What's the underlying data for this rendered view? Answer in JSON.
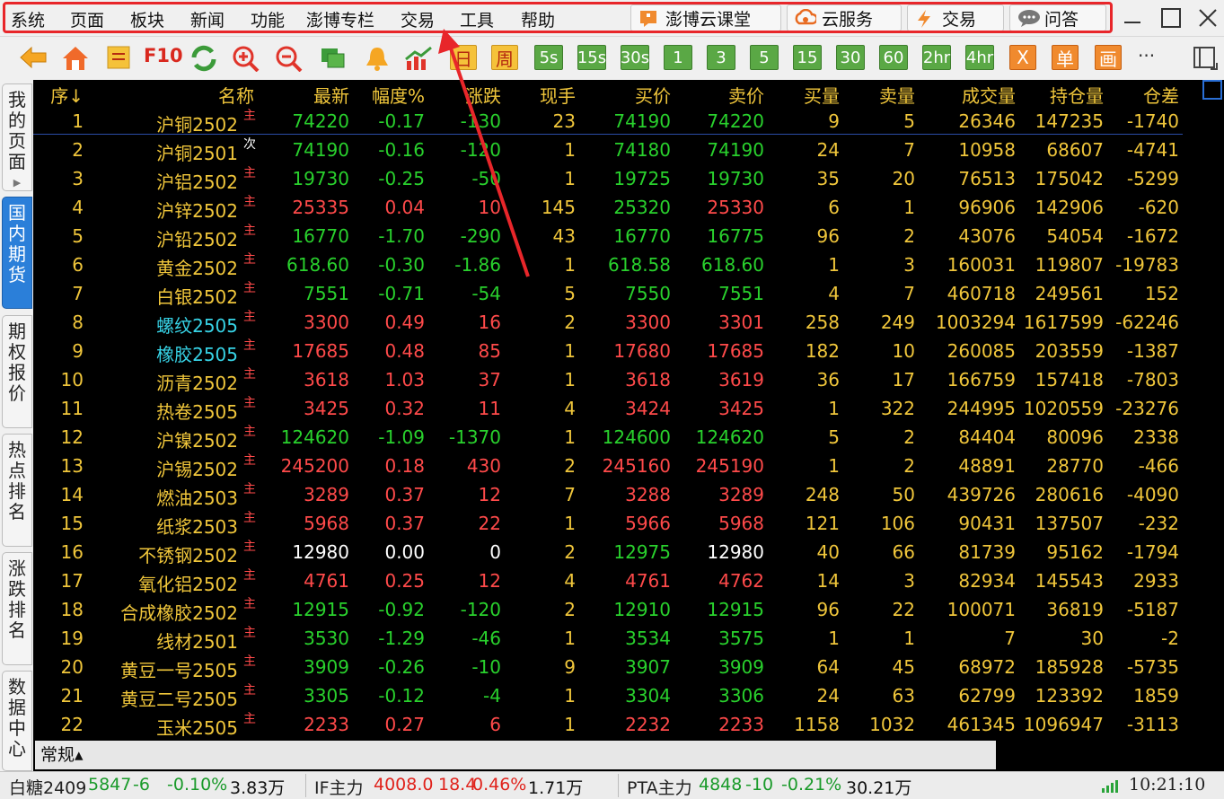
{
  "colors": {
    "up": "#ff4a4a",
    "down": "#29d12d",
    "flat": "#ffffff",
    "yellow": "#f0c63b",
    "cyan": "#37d3e6",
    "highlight": "#e8262a"
  },
  "menu": [
    "系统",
    "页面",
    "板块",
    "新闻",
    "功能",
    "澎博专栏",
    "交易",
    "工具",
    "帮助"
  ],
  "top_buttons": [
    {
      "label": "澎博云课堂",
      "icon": "classroom-icon"
    },
    {
      "label": "云服务",
      "icon": "cloud-service-icon"
    },
    {
      "label": "交易",
      "icon": "lightning-icon"
    },
    {
      "label": "问答",
      "icon": "chat-icon"
    }
  ],
  "toolbar": {
    "f10": "F10",
    "day": "日",
    "week": "周",
    "periods": [
      "5s",
      "15s",
      "30s",
      "1",
      "3",
      "5",
      "15",
      "30",
      "60",
      "2hr",
      "4hr"
    ],
    "x_label": "X",
    "single_label": "单",
    "draw_label": "画",
    "more": "···"
  },
  "sidebar_tabs": [
    {
      "label": "我的页面",
      "active": false,
      "has_arrow": true
    },
    {
      "label": "国内期货",
      "active": true
    },
    {
      "label": "期权报价",
      "active": false
    },
    {
      "label": "热点排名",
      "active": false
    },
    {
      "label": "涨跌排名",
      "active": false
    },
    {
      "label": "数据中心",
      "active": false
    }
  ],
  "columns": [
    "序↓",
    "名称",
    "最新",
    "幅度%",
    "涨跌",
    "现手",
    "买价",
    "卖价",
    "买量",
    "卖量",
    "成交量",
    "持仓量",
    "仓差"
  ],
  "rows": [
    {
      "no": "1",
      "name": "沪铜2502",
      "tag": "主",
      "last": "74220",
      "pct": "-0.17",
      "chg": "-130",
      "hand": "23",
      "bid": "74190",
      "ask": "74220",
      "bidv": "9",
      "askv": "5",
      "vol": "26346",
      "oi": "147235",
      "oic": "-1740",
      "dir": "down",
      "name_color": "yellow"
    },
    {
      "no": "2",
      "name": "沪铜2501",
      "tag": "次",
      "last": "74190",
      "pct": "-0.16",
      "chg": "-120",
      "hand": "1",
      "bid": "74180",
      "ask": "74190",
      "bidv": "24",
      "askv": "7",
      "vol": "10958",
      "oi": "68607",
      "oic": "-4741",
      "dir": "down",
      "name_color": "yellow"
    },
    {
      "no": "3",
      "name": "沪铝2502",
      "tag": "主",
      "last": "19730",
      "pct": "-0.25",
      "chg": "-50",
      "hand": "1",
      "bid": "19725",
      "ask": "19730",
      "bidv": "35",
      "askv": "20",
      "vol": "76513",
      "oi": "175042",
      "oic": "-5299",
      "dir": "down",
      "name_color": "yellow"
    },
    {
      "no": "4",
      "name": "沪锌2502",
      "tag": "主",
      "last": "25335",
      "pct": "0.04",
      "chg": "10",
      "hand": "145",
      "bid": "25320",
      "ask": "25330",
      "bidv": "6",
      "askv": "1",
      "vol": "96906",
      "oi": "142906",
      "oic": "-620",
      "dir": "up",
      "bid_dir": "down",
      "name_color": "yellow"
    },
    {
      "no": "5",
      "name": "沪铅2502",
      "tag": "主",
      "last": "16770",
      "pct": "-1.70",
      "chg": "-290",
      "hand": "43",
      "bid": "16770",
      "ask": "16775",
      "bidv": "96",
      "askv": "2",
      "vol": "43076",
      "oi": "54054",
      "oic": "-1672",
      "dir": "down",
      "name_color": "yellow"
    },
    {
      "no": "6",
      "name": "黄金2502",
      "tag": "主",
      "last": "618.60",
      "pct": "-0.30",
      "chg": "-1.86",
      "hand": "1",
      "bid": "618.58",
      "ask": "618.60",
      "bidv": "1",
      "askv": "3",
      "vol": "160031",
      "oi": "119807",
      "oic": "-19783",
      "dir": "down",
      "name_color": "yellow"
    },
    {
      "no": "7",
      "name": "白银2502",
      "tag": "主",
      "last": "7551",
      "pct": "-0.71",
      "chg": "-54",
      "hand": "5",
      "bid": "7550",
      "ask": "7551",
      "bidv": "4",
      "askv": "7",
      "vol": "460718",
      "oi": "249561",
      "oic": "152",
      "dir": "down",
      "name_color": "yellow"
    },
    {
      "no": "8",
      "name": "螺纹2505",
      "tag": "主",
      "last": "3300",
      "pct": "0.49",
      "chg": "16",
      "hand": "2",
      "bid": "3300",
      "ask": "3301",
      "bidv": "258",
      "askv": "249",
      "vol": "1003294",
      "oi": "1617599",
      "oic": "-62246",
      "dir": "up",
      "name_color": "cyan"
    },
    {
      "no": "9",
      "name": "橡胶2505",
      "tag": "主",
      "last": "17685",
      "pct": "0.48",
      "chg": "85",
      "hand": "1",
      "bid": "17680",
      "ask": "17685",
      "bidv": "182",
      "askv": "10",
      "vol": "260085",
      "oi": "203559",
      "oic": "-1387",
      "dir": "up",
      "name_color": "cyan"
    },
    {
      "no": "10",
      "name": "沥青2502",
      "tag": "主",
      "last": "3618",
      "pct": "1.03",
      "chg": "37",
      "hand": "1",
      "bid": "3618",
      "ask": "3619",
      "bidv": "36",
      "askv": "17",
      "vol": "166759",
      "oi": "157418",
      "oic": "-7803",
      "dir": "up",
      "name_color": "yellow"
    },
    {
      "no": "11",
      "name": "热卷2505",
      "tag": "主",
      "last": "3425",
      "pct": "0.32",
      "chg": "11",
      "hand": "4",
      "bid": "3424",
      "ask": "3425",
      "bidv": "1",
      "askv": "322",
      "vol": "244995",
      "oi": "1020559",
      "oic": "-23276",
      "dir": "up",
      "name_color": "yellow"
    },
    {
      "no": "12",
      "name": "沪镍2502",
      "tag": "主",
      "last": "124620",
      "pct": "-1.09",
      "chg": "-1370",
      "hand": "1",
      "bid": "124600",
      "ask": "124620",
      "bidv": "5",
      "askv": "2",
      "vol": "84404",
      "oi": "80096",
      "oic": "2338",
      "dir": "down",
      "name_color": "yellow"
    },
    {
      "no": "13",
      "name": "沪锡2502",
      "tag": "主",
      "last": "245200",
      "pct": "0.18",
      "chg": "430",
      "hand": "2",
      "bid": "245160",
      "ask": "245190",
      "bidv": "1",
      "askv": "2",
      "vol": "48891",
      "oi": "28770",
      "oic": "-466",
      "dir": "up",
      "name_color": "yellow"
    },
    {
      "no": "14",
      "name": "燃油2503",
      "tag": "主",
      "last": "3289",
      "pct": "0.37",
      "chg": "12",
      "hand": "7",
      "bid": "3288",
      "ask": "3289",
      "bidv": "248",
      "askv": "50",
      "vol": "439726",
      "oi": "280616",
      "oic": "-4090",
      "dir": "up",
      "name_color": "yellow"
    },
    {
      "no": "15",
      "name": "纸浆2503",
      "tag": "主",
      "last": "5968",
      "pct": "0.37",
      "chg": "22",
      "hand": "1",
      "bid": "5966",
      "ask": "5968",
      "bidv": "121",
      "askv": "106",
      "vol": "90431",
      "oi": "137507",
      "oic": "-232",
      "dir": "up",
      "name_color": "yellow"
    },
    {
      "no": "16",
      "name": "不锈钢2502",
      "tag": "主",
      "last": "12980",
      "pct": "0.00",
      "chg": "0",
      "hand": "2",
      "bid": "12975",
      "ask": "12980",
      "bidv": "40",
      "askv": "66",
      "vol": "81739",
      "oi": "95162",
      "oic": "-1794",
      "dir": "flat",
      "bid_dir": "down",
      "name_color": "yellow"
    },
    {
      "no": "17",
      "name": "氧化铝2502",
      "tag": "主",
      "last": "4761",
      "pct": "0.25",
      "chg": "12",
      "hand": "4",
      "bid": "4761",
      "ask": "4762",
      "bidv": "14",
      "askv": "3",
      "vol": "82934",
      "oi": "145543",
      "oic": "2933",
      "dir": "up",
      "name_color": "yellow"
    },
    {
      "no": "18",
      "name": "合成橡胶2502",
      "tag": "主",
      "last": "12915",
      "pct": "-0.92",
      "chg": "-120",
      "hand": "2",
      "bid": "12910",
      "ask": "12915",
      "bidv": "96",
      "askv": "22",
      "vol": "100071",
      "oi": "36819",
      "oic": "-5187",
      "dir": "down",
      "name_color": "yellow"
    },
    {
      "no": "19",
      "name": "线材2501",
      "tag": "主",
      "last": "3530",
      "pct": "-1.29",
      "chg": "-46",
      "hand": "1",
      "bid": "3534",
      "ask": "3575",
      "bidv": "1",
      "askv": "1",
      "vol": "7",
      "oi": "30",
      "oic": "-2",
      "dir": "down",
      "name_color": "yellow"
    },
    {
      "no": "20",
      "name": "黄豆一号2505",
      "tag": "主",
      "last": "3909",
      "pct": "-0.26",
      "chg": "-10",
      "hand": "9",
      "bid": "3907",
      "ask": "3909",
      "bidv": "64",
      "askv": "45",
      "vol": "68972",
      "oi": "185928",
      "oic": "-5735",
      "dir": "down",
      "name_color": "yellow"
    },
    {
      "no": "21",
      "name": "黄豆二号2505",
      "tag": "主",
      "last": "3305",
      "pct": "-0.12",
      "chg": "-4",
      "hand": "1",
      "bid": "3304",
      "ask": "3306",
      "bidv": "24",
      "askv": "63",
      "vol": "62799",
      "oi": "123392",
      "oic": "1859",
      "dir": "down",
      "name_color": "yellow"
    },
    {
      "no": "22",
      "name": "玉米2505",
      "tag": "主",
      "last": "2233",
      "pct": "0.27",
      "chg": "6",
      "hand": "1",
      "bid": "2232",
      "ask": "2233",
      "bidv": "1158",
      "askv": "1032",
      "vol": "461345",
      "oi": "1096947",
      "oic": "-3113",
      "dir": "up",
      "name_color": "yellow"
    }
  ],
  "bottom_tab": "常规▴",
  "status": {
    "items": [
      {
        "name": "白糖2409",
        "last": "5847",
        "chg": "-6",
        "pct": "-0.10%",
        "vol": "3.83万",
        "dir": "down"
      },
      {
        "name": "IF主力",
        "last": "4008.0",
        "chg": "18.4",
        "pct": "0.46%",
        "vol": "1.71万",
        "dir": "up"
      },
      {
        "name": "PTA主力",
        "last": "4848",
        "chg": "-10",
        "pct": "-0.21%",
        "vol": "30.21万",
        "dir": "down"
      }
    ],
    "time": "10:21:10"
  }
}
